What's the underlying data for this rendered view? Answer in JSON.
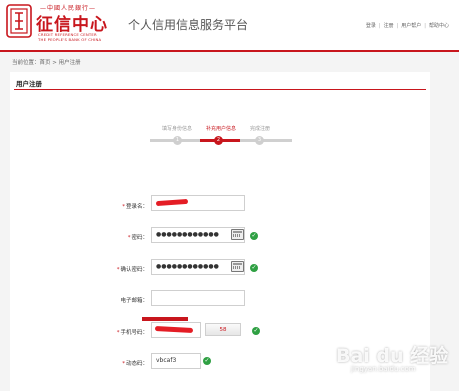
{
  "header": {
    "logo_top": "—中國人民銀行—",
    "logo_main": "征信中心",
    "logo_en_line1": "CREDIT REFERENCE CENTER",
    "logo_en_line2": "THE PEOPLE'S BANK OF CHINA",
    "site_title": "个人信用信息服务平台",
    "nav": [
      "登录",
      "注册",
      "用户帮户",
      "帮助中心"
    ]
  },
  "breadcrumb": "当前位置：首页 > 用户注册",
  "panel_title": "用户注册",
  "steps": [
    {
      "label": "填写身份信息",
      "num": "1",
      "active": false
    },
    {
      "label": "补充用户信息",
      "num": "2",
      "active": true
    },
    {
      "label": "完成注册",
      "num": "3",
      "active": false
    }
  ],
  "form": {
    "login_label": "登录名：",
    "password_label": "密码：",
    "password_value": "●●●●●●●●●●●●",
    "confirm_label": "确认密码：",
    "confirm_value": "●●●●●●●●●●●●",
    "email_label": "电子邮箱：",
    "email_value": "",
    "phone_label": "手机号码：",
    "sms_button": "58",
    "code_label": "动态码：",
    "code_value": "vbcaf3",
    "required_mark": "*"
  },
  "watermark": {
    "main": "Bai du 经验",
    "sub": "jingyan.baidu.com"
  },
  "colors": {
    "brand": "#c8161d",
    "check": "#2fa043"
  }
}
